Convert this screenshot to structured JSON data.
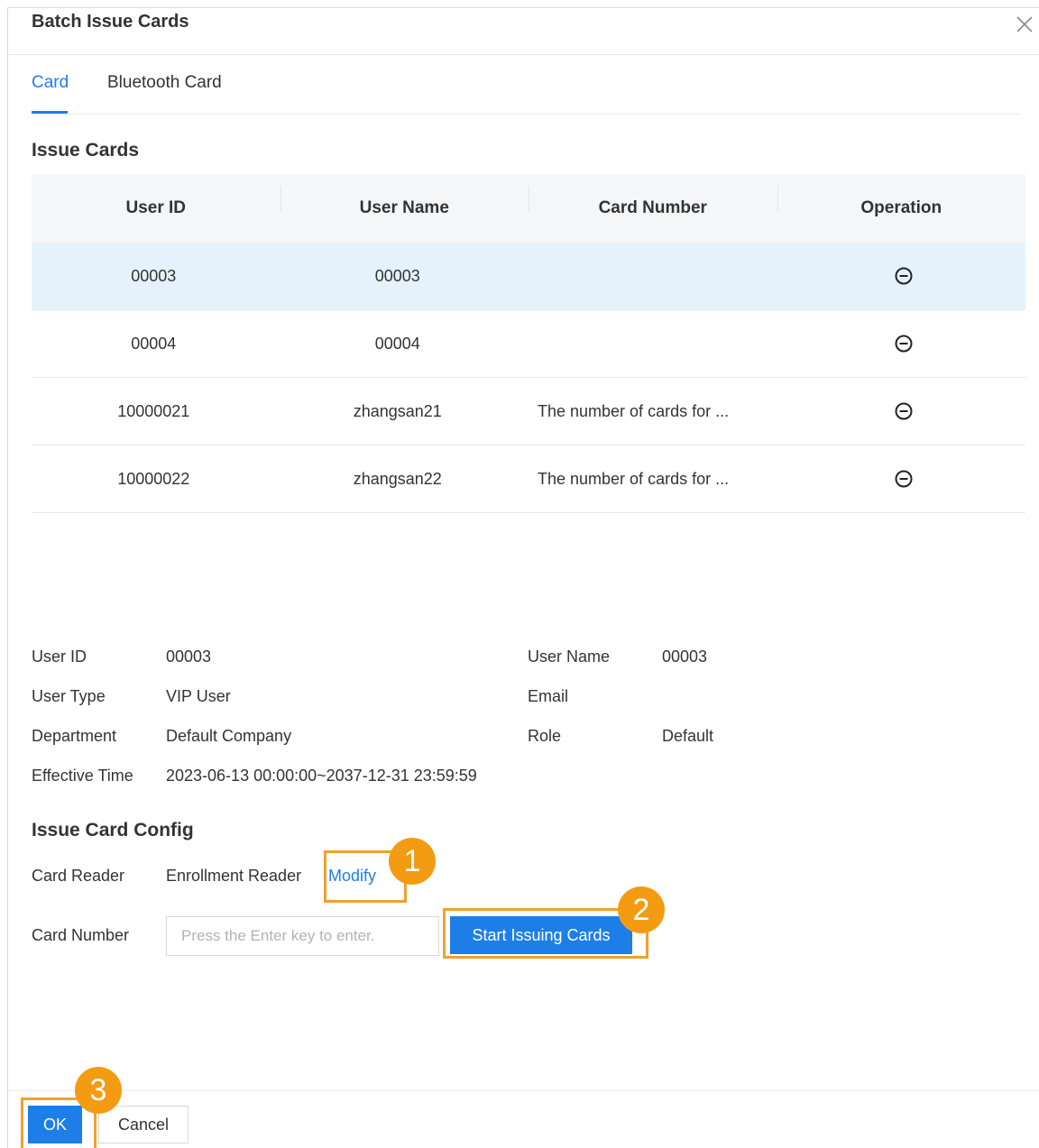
{
  "dialog": {
    "title": "Batch Issue Cards"
  },
  "tabs": [
    {
      "label": "Card",
      "active": true
    },
    {
      "label": "Bluetooth Card",
      "active": false
    }
  ],
  "issue_cards": {
    "title": "Issue Cards",
    "columns": [
      "User ID",
      "User Name",
      "Card Number",
      "Operation"
    ],
    "rows": [
      {
        "user_id": "00003",
        "user_name": "00003",
        "card_number": "",
        "selected": true
      },
      {
        "user_id": "00004",
        "user_name": "00004",
        "card_number": "",
        "selected": false
      },
      {
        "user_id": "10000021",
        "user_name": "zhangsan21",
        "card_number": "The number of cards for ...",
        "selected": false
      },
      {
        "user_id": "10000022",
        "user_name": "zhangsan22",
        "card_number": "The number of cards for ...",
        "selected": false
      }
    ]
  },
  "details": {
    "user_id_label": "User ID",
    "user_id": "00003",
    "user_name_label": "User Name",
    "user_name": "00003",
    "user_type_label": "User Type",
    "user_type": "VIP User",
    "email_label": "Email",
    "email": "",
    "department_label": "Department",
    "department": "Default Company",
    "role_label": "Role",
    "role": "Default",
    "effective_time_label": "Effective Time",
    "effective_time": "2023-06-13 00:00:00~2037-12-31 23:59:59"
  },
  "config": {
    "title": "Issue Card Config",
    "card_reader_label": "Card Reader",
    "card_reader_value": "Enrollment Reader",
    "modify_label": "Modify",
    "card_number_label": "Card Number",
    "card_number_placeholder": "Press the Enter key to enter.",
    "start_label": "Start Issuing Cards"
  },
  "footer": {
    "ok_label": "OK",
    "cancel_label": "Cancel"
  },
  "callouts": [
    "1",
    "2",
    "3"
  ],
  "colors": {
    "accent": "#1e7ee8",
    "highlight": "#f0a030",
    "badge": "#f39c12",
    "selected_row": "#e5f2fc"
  },
  "icons": {
    "close": "close-icon",
    "remove": "minus-circle-icon"
  }
}
